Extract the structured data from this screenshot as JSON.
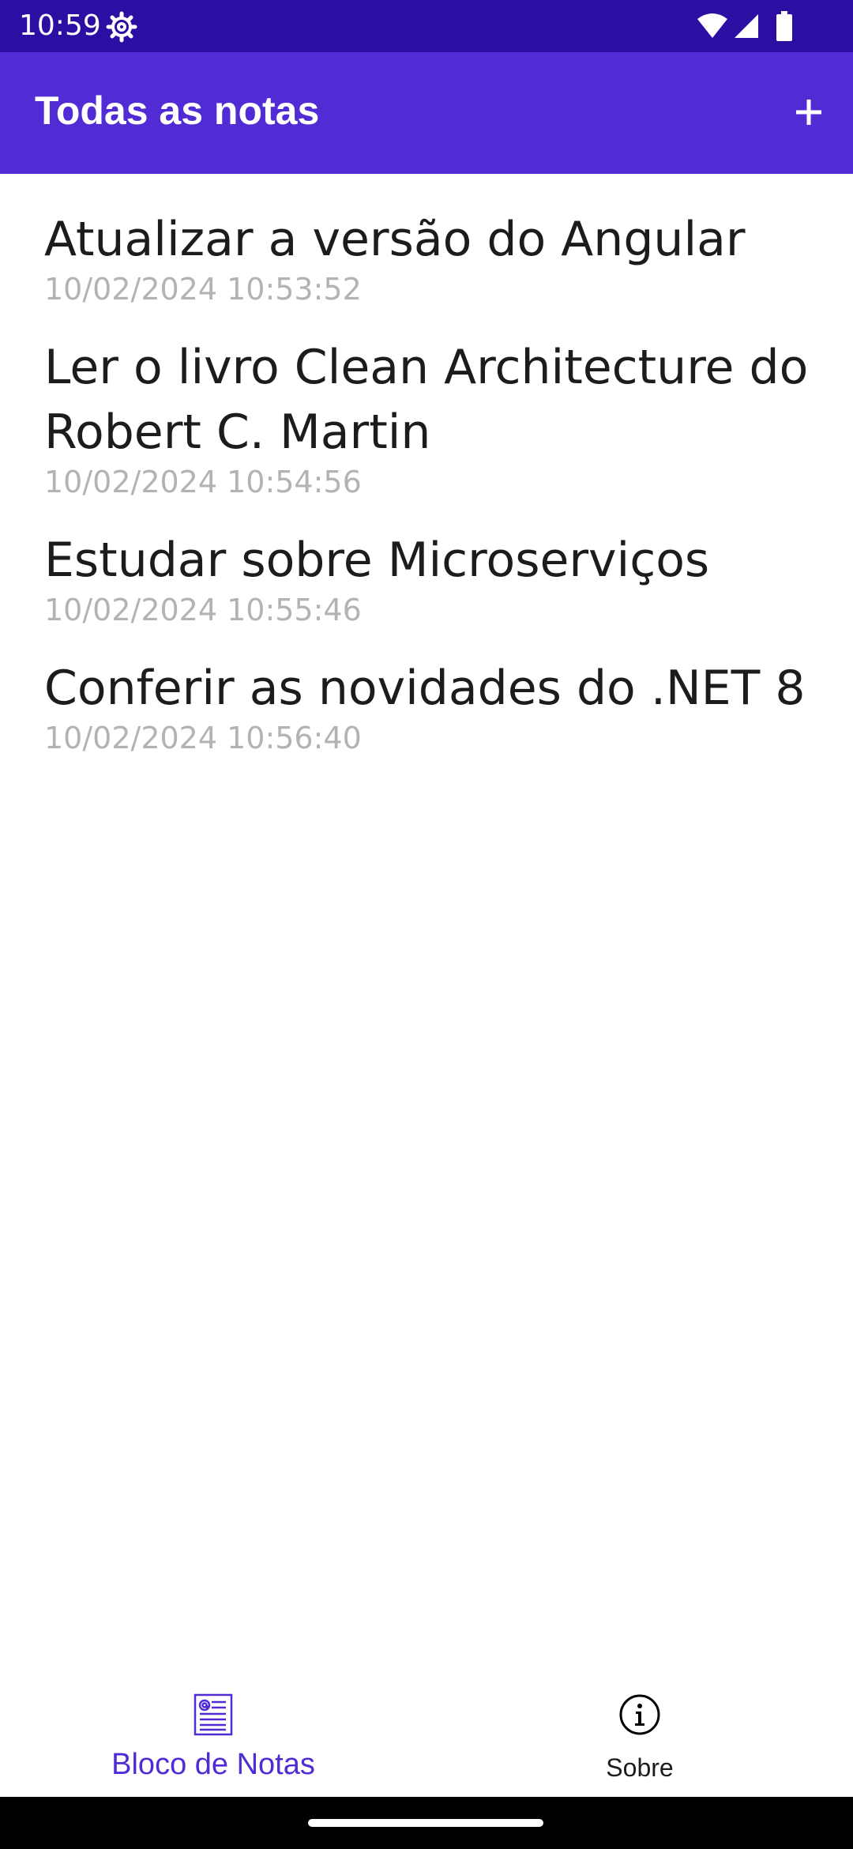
{
  "status_bar": {
    "time": "10:59",
    "icons": [
      "gear-icon",
      "wifi-icon",
      "signal-icon",
      "battery-icon"
    ],
    "background": "#2c0ea3"
  },
  "app_bar": {
    "title": "Todas as notas",
    "add_icon": "plus-icon",
    "background": "#512bd4"
  },
  "notes": [
    {
      "title": "Atualizar a versão do Angular",
      "date": "10/02/2024 10:53:52"
    },
    {
      "title": "Ler o livro Clean Architecture do Robert C. Martin",
      "date": "10/02/2024 10:54:56"
    },
    {
      "title": "Estudar sobre Microserviços",
      "date": "10/02/2024 10:55:46"
    },
    {
      "title": "Conferir as novidades do .NET 8",
      "date": "10/02/2024 10:56:40"
    }
  ],
  "bottom_nav": {
    "tabs": [
      {
        "label": "Bloco de Notas",
        "icon": "notepad-icon",
        "selected": true
      },
      {
        "label": "Sobre",
        "icon": "info-icon",
        "selected": false
      }
    ],
    "accent": "#512bd4"
  }
}
